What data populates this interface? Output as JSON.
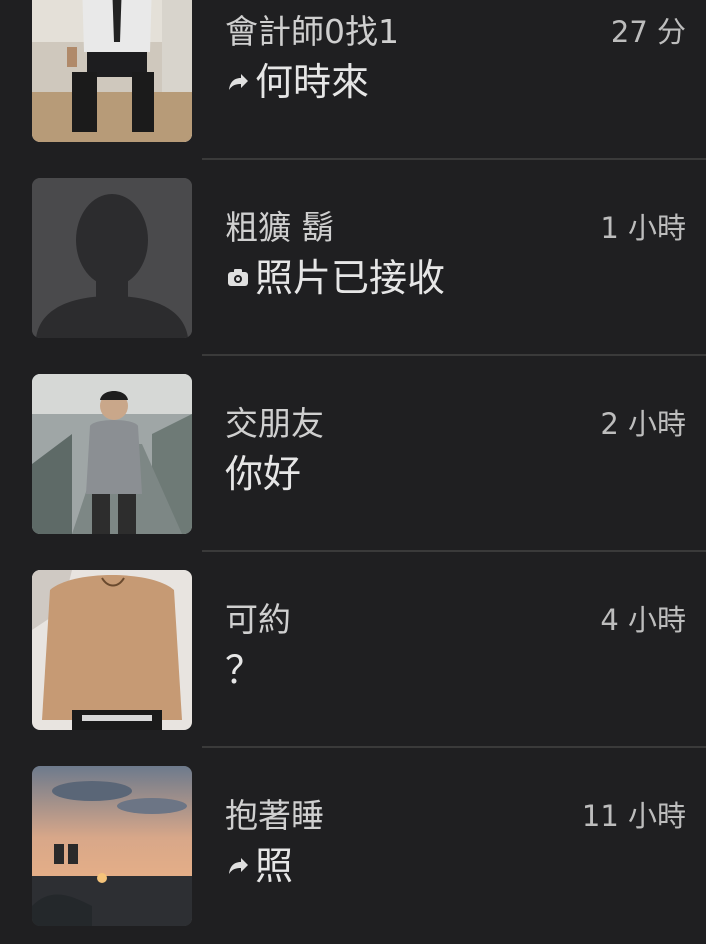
{
  "colors": {
    "background": "#1f1f21",
    "divider": "#3a3a3a",
    "name_text": "#cfcfcf",
    "preview_text": "#e6e6e6",
    "time_text": "#bdbdbd"
  },
  "conversations": [
    {
      "name": "會計師0找1",
      "time": "27 分",
      "preview_icon": "forward-arrow-icon",
      "preview": "何時來",
      "avatar": "profile-photo-man-in-suit"
    },
    {
      "name": "粗獷 鬍",
      "time": "1 小時",
      "preview_icon": "camera-icon",
      "preview": "照片已接收",
      "avatar": "default-silhouette-avatar"
    },
    {
      "name": "交朋友",
      "time": "2 小時",
      "preview_icon": "",
      "preview": "你好",
      "avatar": "profile-photo-escalator"
    },
    {
      "name": "可約",
      "time": "4 小時",
      "preview_icon": "",
      "preview": "？",
      "avatar": "profile-photo-shirtless"
    },
    {
      "name": "抱著睡",
      "time": "11 小時",
      "preview_icon": "forward-arrow-icon",
      "preview": "照",
      "avatar": "profile-photo-sunset"
    }
  ]
}
